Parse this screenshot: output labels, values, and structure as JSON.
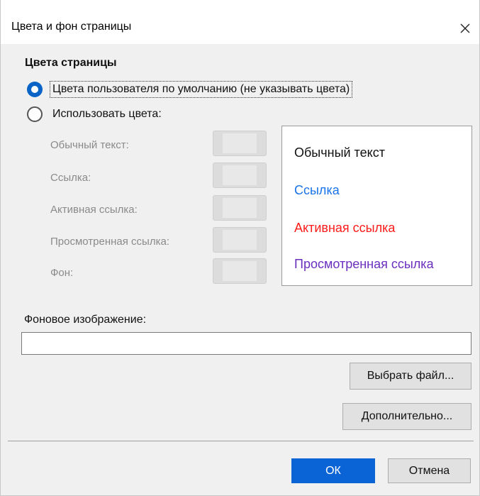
{
  "dialog": {
    "title": "Цвета и фон страницы",
    "close_icon": "close-icon"
  },
  "page_colors": {
    "heading": "Цвета страницы",
    "options": [
      {
        "label": "Цвета пользователя по умолчанию (не указывать цвета)",
        "checked": true
      },
      {
        "label": "Использовать цвета:",
        "checked": false
      }
    ],
    "color_rows": [
      {
        "label": "Обычный текст:"
      },
      {
        "label": "Ссылка:"
      },
      {
        "label": "Активная ссылка:"
      },
      {
        "label": "Просмотренная ссылка:"
      },
      {
        "label": "Фон:"
      }
    ]
  },
  "preview": {
    "normal_text": "Обычный текст",
    "link": "Ссылка",
    "active_link": "Активная ссылка",
    "visited_link": "Просмотренная ссылка",
    "colors": {
      "normal": "#111111",
      "link": "#1a73e8",
      "active": "#ff1a1a",
      "visited": "#6a2fbf"
    }
  },
  "background_image": {
    "label": "Фоновое изображение:",
    "value": "",
    "choose_file": "Выбрать файл..."
  },
  "buttons": {
    "advanced": "Дополнительно...",
    "ok": "ОК",
    "cancel": "Отмена"
  },
  "colors": {
    "accent": "#0a64d6",
    "dialog_bg": "#f0f0f0"
  }
}
